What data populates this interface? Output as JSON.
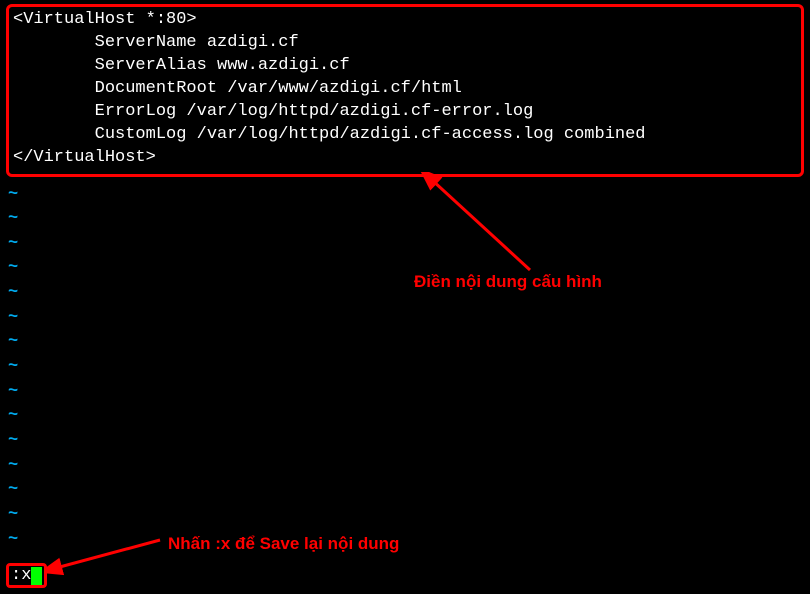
{
  "config": {
    "line1": "<VirtualHost *:80>",
    "line2": "        ServerName azdigi.cf",
    "line3": "        ServerAlias www.azdigi.cf",
    "line4": "        DocumentRoot /var/www/azdigi.cf/html",
    "line5": "        ErrorLog /var/log/httpd/azdigi.cf-error.log",
    "line6": "        CustomLog /var/log/httpd/azdigi.cf-access.log combined",
    "line7": "</VirtualHost>"
  },
  "tilde_char": "~",
  "command": ":x",
  "annotations": {
    "config_label": "Điền nội dung cấu hình",
    "save_label": "Nhấn :x để Save lại nội dung"
  }
}
